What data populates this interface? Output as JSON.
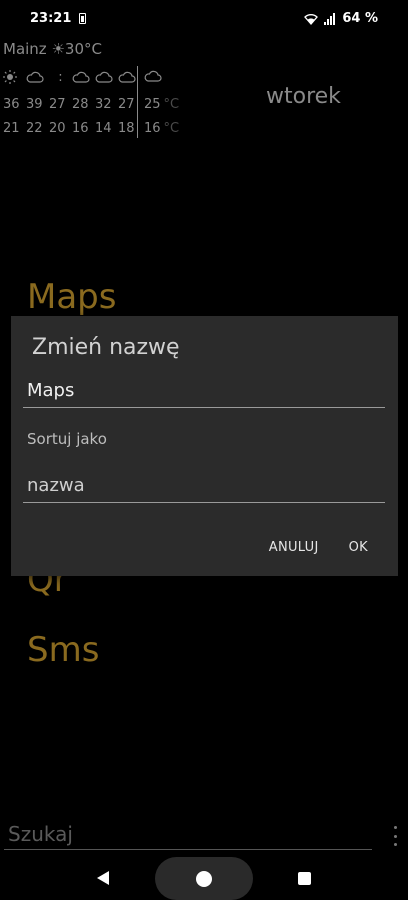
{
  "status_bar": {
    "time": "23:21",
    "battery_percent": "64 %"
  },
  "weather": {
    "city": "Mainz",
    "current_temp": "30°C",
    "current_icon": "sun-icon",
    "day_icons": [
      "sun-icon",
      "cloud-icon",
      "colon",
      "cloud-icon",
      "cloud-icon",
      "cloud-icon"
    ],
    "tail_icon": "cloud-icon",
    "highs": [
      "36",
      "39",
      "27",
      "28",
      "32",
      "27"
    ],
    "lows": [
      "21",
      "22",
      "20",
      "16",
      "14",
      "18"
    ],
    "tail_high": "25",
    "tail_low": "16",
    "unit": "°C"
  },
  "weekday": "wtorek",
  "apps": [
    "Maps",
    "Qr",
    "Sms"
  ],
  "dialog": {
    "title": "Zmień nazwę",
    "name_value": "Maps",
    "sort_label": "Sortuj jako",
    "sort_value": "nazwa",
    "cancel_label": "ANULUJ",
    "ok_label": "OK"
  },
  "search": {
    "placeholder": "Szukaj"
  }
}
